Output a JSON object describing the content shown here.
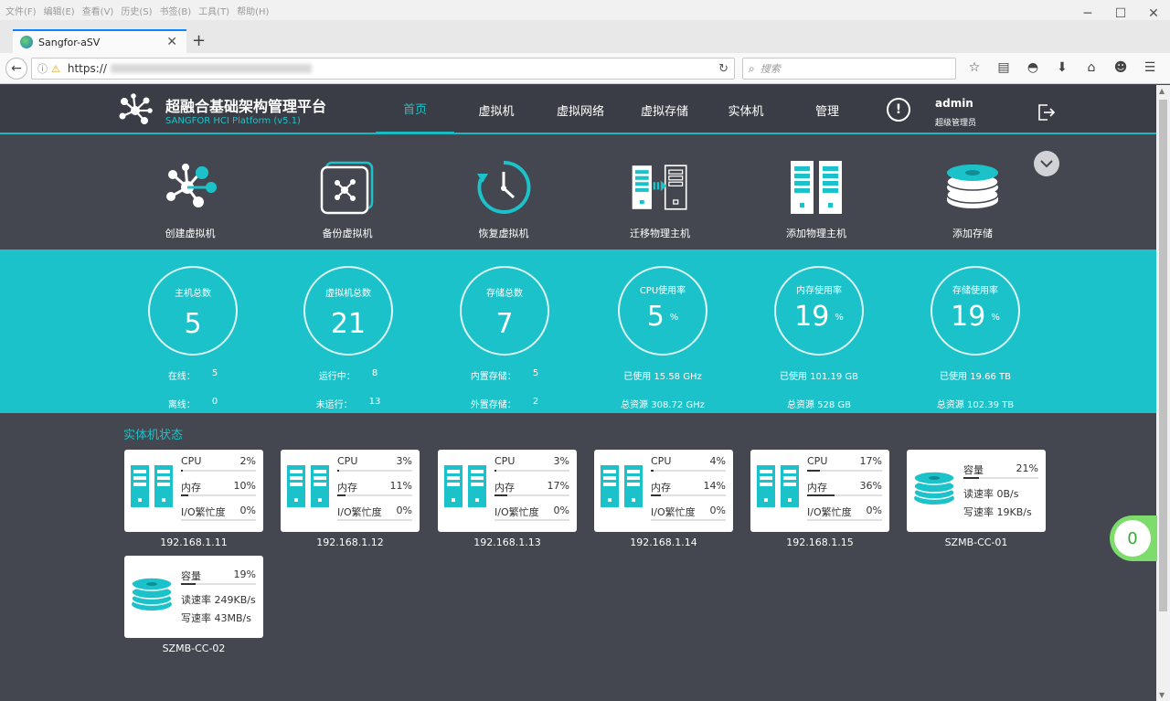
{
  "browser": {
    "menu": [
      "文件(F)",
      "编辑(E)",
      "查看(V)",
      "历史(S)",
      "书签(B)",
      "工具(T)",
      "帮助(H)"
    ],
    "tab_title": "Sangfor-aSV",
    "url_scheme": "https://",
    "search_placeholder": "搜索"
  },
  "header": {
    "brand_cn": "超融合基础架构管理平台",
    "brand_en": "SANGFOR HCI Platform (v5.1)",
    "nav": [
      "首页",
      "虚拟机",
      "虚拟网络",
      "虚拟存储",
      "实体机",
      "管理"
    ],
    "active_nav": "首页",
    "user": "admin",
    "role": "超级管理员"
  },
  "quick_actions": [
    "创建虚拟机",
    "备份虚拟机",
    "恢复虚拟机",
    "迁移物理主机",
    "添加物理主机",
    "添加存储"
  ],
  "stats": [
    {
      "label": "主机总数",
      "value": "5",
      "unit": "",
      "rows": [
        [
          "在线：",
          "5"
        ],
        [
          "离线：",
          "0"
        ]
      ]
    },
    {
      "label": "虚拟机总数",
      "value": "21",
      "unit": "",
      "rows": [
        [
          "运行中：",
          "8"
        ],
        [
          "未运行：",
          "13"
        ]
      ]
    },
    {
      "label": "存储总数",
      "value": "7",
      "unit": "",
      "rows": [
        [
          "内置存储：",
          "5"
        ],
        [
          "外置存储：",
          "2"
        ]
      ]
    },
    {
      "label": "CPU使用率",
      "value": "5",
      "unit": "%",
      "rows": [
        [
          "已使用 15.58 GHz",
          ""
        ],
        [
          "总资源 308.72 GHz",
          ""
        ]
      ]
    },
    {
      "label": "内存使用率",
      "value": "19",
      "unit": "%",
      "rows": [
        [
          "已使用 101.19 GB",
          ""
        ],
        [
          "总资源 528 GB",
          ""
        ]
      ]
    },
    {
      "label": "存储使用率",
      "value": "19",
      "unit": "%",
      "rows": [
        [
          "已使用 19.66 TB",
          ""
        ],
        [
          "总资源 102.39 TB",
          ""
        ]
      ]
    }
  ],
  "hosts_title": "实体机状态",
  "hosts": [
    {
      "name": "192.168.1.11",
      "cpu": "2%",
      "mem": "10%",
      "io": "0%",
      "cpu_v": 0.02,
      "mem_v": 0.1,
      "io_v": 0
    },
    {
      "name": "192.168.1.12",
      "cpu": "3%",
      "mem": "11%",
      "io": "0%",
      "cpu_v": 0.03,
      "mem_v": 0.11,
      "io_v": 0
    },
    {
      "name": "192.168.1.13",
      "cpu": "3%",
      "mem": "17%",
      "io": "0%",
      "cpu_v": 0.03,
      "mem_v": 0.17,
      "io_v": 0
    },
    {
      "name": "192.168.1.14",
      "cpu": "4%",
      "mem": "14%",
      "io": "0%",
      "cpu_v": 0.04,
      "mem_v": 0.14,
      "io_v": 0
    },
    {
      "name": "192.168.1.15",
      "cpu": "17%",
      "mem": "36%",
      "io": "0%",
      "cpu_v": 0.17,
      "mem_v": 0.36,
      "io_v": 0
    }
  ],
  "metric_labels": {
    "cpu": "CPU",
    "mem": "内存",
    "io": "I/O繁忙度",
    "cap": "容量",
    "read": "读速率",
    "write": "写速率"
  },
  "storages": [
    {
      "name": "SZMB-CC-01",
      "cap": "21%",
      "cap_v": 0.21,
      "read": "0B/s",
      "write": "19KB/s"
    },
    {
      "name": "SZMB-CC-02",
      "cap": "19%",
      "cap_v": 0.19,
      "read": "249KB/s",
      "write": "43MB/s"
    }
  ],
  "notification_count": "0",
  "colors": {
    "accent": "#1cc2c9",
    "panel": "#44474f",
    "header": "#3a3d45"
  }
}
